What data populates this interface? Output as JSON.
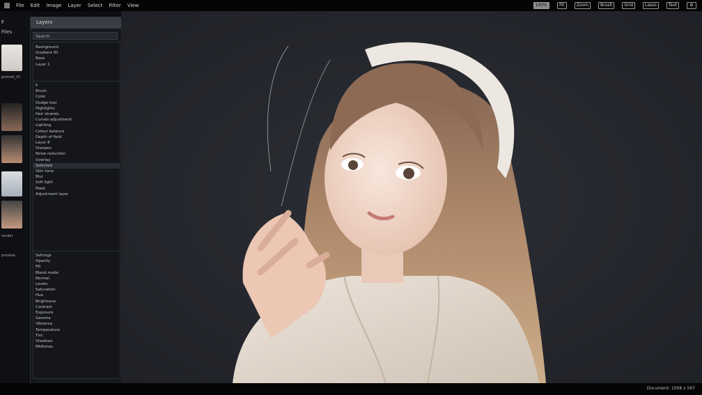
{
  "menu": [
    "File",
    "Edit",
    "Image",
    "Layer",
    "Select",
    "Filter",
    "View"
  ],
  "toolbar": [
    "100%",
    "Fit",
    "Zoom",
    "Brush",
    "Grid",
    "Lasso",
    "Text"
  ],
  "thumbs": {
    "title": "Files",
    "tab": "F",
    "captions": [
      "portrait_01",
      "render",
      "preview"
    ]
  },
  "panel": {
    "tab": "Layers",
    "search": "Search",
    "group1": [
      "Background",
      "Gradient fill",
      "Base",
      "Layer 1"
    ],
    "group2": [
      "P",
      "Brush",
      "Color",
      "Dodge tool",
      "Highlights",
      "Hair strands",
      "Curves adjustment",
      "Lighting",
      "Colour balance",
      "Depth of field",
      "Layer 8",
      "Sharpen",
      "Noise reduction",
      "Overlay",
      "Selected",
      "Skin tone",
      "Blur",
      "Soft light",
      "Mask",
      "Adjustment layer"
    ],
    "group3": [
      "Settings",
      "Opacity",
      "Fill",
      "Blend mode",
      "Normal",
      "Levels",
      "Saturation",
      "Hue",
      "Brightness",
      "Contrast",
      "Exposure",
      "Gamma",
      "Vibrance",
      "Temperature",
      "Tint",
      "Shadows",
      "Midtones"
    ]
  },
  "status": "Document: 1008 x 567"
}
